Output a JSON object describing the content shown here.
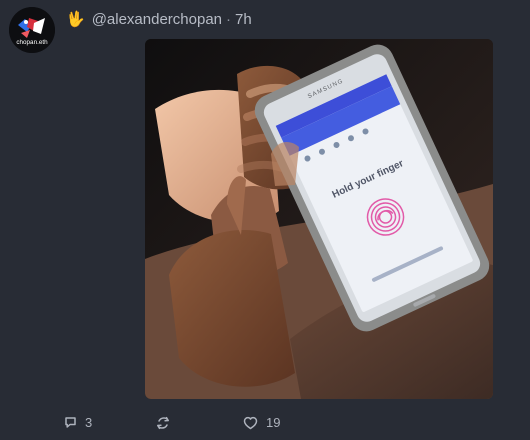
{
  "post": {
    "avatar_text": "chopan.eth",
    "emoji": "🖖",
    "handle": "@alexanderchopan",
    "separator": "·",
    "time": "7h",
    "image_text": {
      "phone_brand": "SAMSUNG",
      "screen_prompt": "Hold your finger"
    },
    "actions": {
      "reply_count": "3",
      "like_count": "19"
    }
  },
  "colors": {
    "background": "#282c35",
    "text": "#b7bcc6",
    "muted": "#8f95a1",
    "emoji": "#f2c23a",
    "fingerprint": "#e25aa8"
  },
  "icons": {
    "reply": "comment-icon",
    "repost": "repost-icon",
    "like": "heart-icon"
  }
}
